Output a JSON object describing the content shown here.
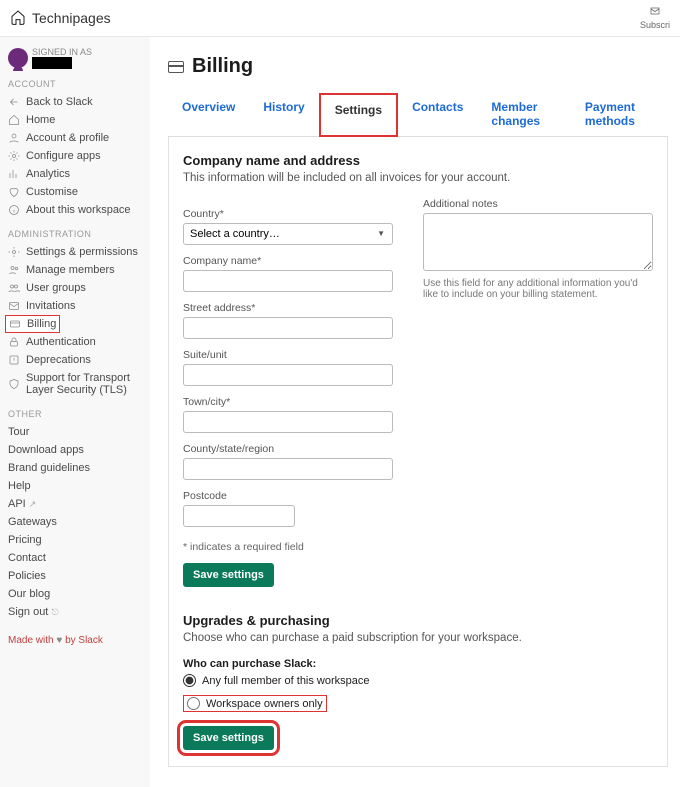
{
  "topbar": {
    "brand": "Technipages",
    "subscribe": "Subscri"
  },
  "signed": {
    "label": "SIGNED IN AS"
  },
  "sidebar": {
    "account_head": "ACCOUNT",
    "account": [
      {
        "label": "Back to Slack"
      },
      {
        "label": "Home"
      },
      {
        "label": "Account & profile"
      },
      {
        "label": "Configure apps"
      },
      {
        "label": "Analytics"
      },
      {
        "label": "Customise"
      },
      {
        "label": "About this workspace"
      }
    ],
    "admin_head": "ADMINISTRATION",
    "admin": [
      {
        "label": "Settings & permissions"
      },
      {
        "label": "Manage members"
      },
      {
        "label": "User groups"
      },
      {
        "label": "Invitations"
      },
      {
        "label": "Billing",
        "hl": true
      },
      {
        "label": "Authentication"
      },
      {
        "label": "Deprecations"
      },
      {
        "label": "Support for Transport Layer Security (TLS)"
      }
    ],
    "other_head": "OTHER",
    "other": [
      "Tour",
      "Download apps",
      "Brand guidelines",
      "Help",
      "API",
      "Gateways",
      "Pricing",
      "Contact",
      "Policies",
      "Our blog",
      "Sign out"
    ],
    "made": {
      "p1": "Made with",
      "heart": "♥",
      "p2": "by Slack"
    }
  },
  "page": {
    "title": "Billing",
    "tabs": [
      "Overview",
      "History",
      "Settings",
      "Contacts",
      "Member changes",
      "Payment methods"
    ],
    "active_tab": "Settings",
    "section": {
      "heading": "Company name and address",
      "sub": "This information will be included on all invoices for your account."
    },
    "labels": {
      "country": "Country*",
      "country_placeholder": "Select a country…",
      "company": "Company name*",
      "street": "Street address*",
      "suite": "Suite/unit",
      "town": "Town/city*",
      "county": "County/state/region",
      "post": "Postcode",
      "notes": "Additional notes",
      "notes_hint": "Use this field for any additional information you'd like to include on your billing statement.",
      "required": "* indicates a required field",
      "save": "Save settings"
    },
    "upgrades": {
      "heading": "Upgrades & purchasing",
      "sub": "Choose who can purchase a paid subscription for your workspace.",
      "who": "Who can purchase Slack:",
      "opt1": "Any full member of this workspace",
      "opt2": "Workspace owners only",
      "save": "Save settings"
    }
  }
}
